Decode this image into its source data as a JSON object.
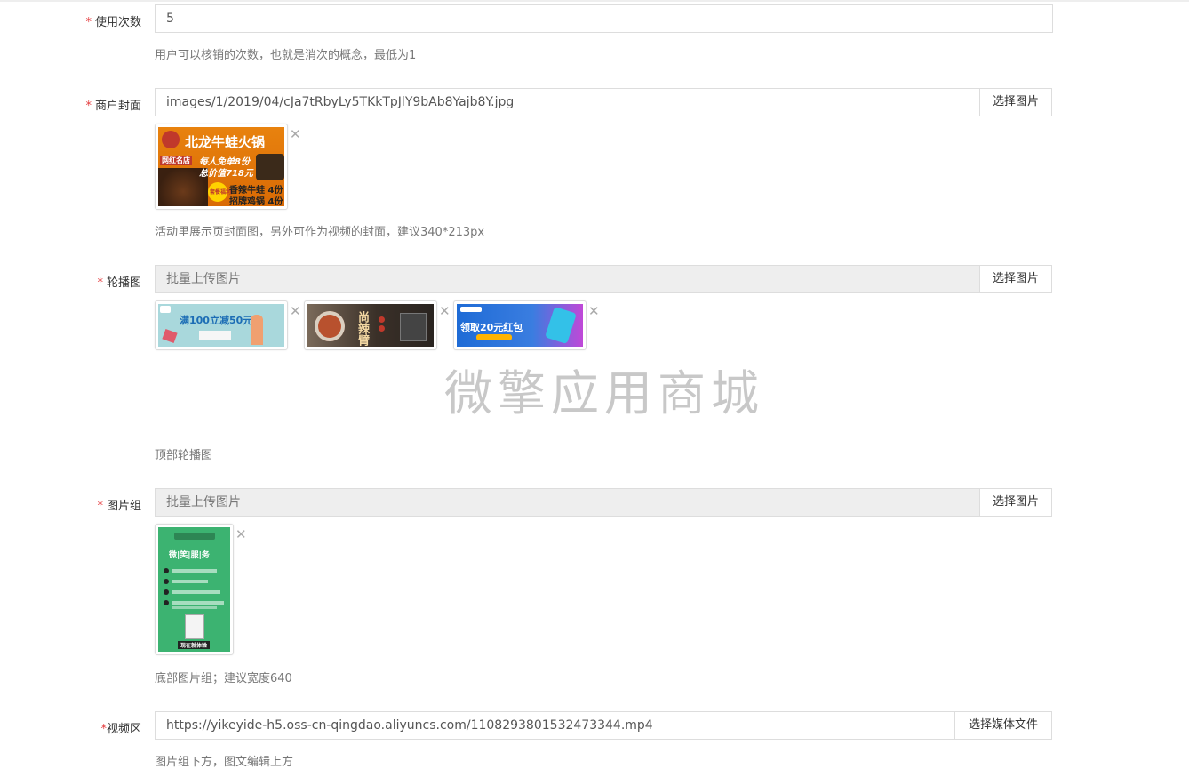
{
  "form": {
    "usage_count": {
      "label": "使用次数",
      "value": "5",
      "help": "用户可以核销的次数，也就是消次的概念，最低为1"
    },
    "merchant_cover": {
      "label": "商户封面",
      "value": "images/1/2019/04/cJa7tRbyLy5TKkTpJlY9bAb8Yajb8Y.jpg",
      "button": "选择图片",
      "help": "活动里展示页封面图，另外可作为视频的封面，建议340*213px",
      "image_text": {
        "headline": "北龙牛蛙火锅",
        "line1": "每人免单8份",
        "line2": "总价值718元",
        "badge": "网红名店",
        "item1": "香辣牛蛙 4份",
        "item2": "招牌鸡锅 4份",
        "seal": "套餐福利"
      }
    },
    "carousel": {
      "label": "轮播图",
      "placeholder": "批量上传图片",
      "button": "选择图片",
      "help": "顶部轮播图",
      "images": [
        {
          "text": "满100立减50元"
        },
        {
          "text": "尚辣臂"
        },
        {
          "text": "领取20元红包"
        }
      ]
    },
    "image_group": {
      "label": "图片组",
      "placeholder": "批量上传图片",
      "button": "选择图片",
      "help": "底部图片组；建议宽度640",
      "image_text": {
        "title": "微|笑|服|务",
        "cta": "现在就体验"
      }
    },
    "video": {
      "label": "视频区",
      "value": "https://yikeyide-h5.oss-cn-qingdao.aliyuncs.com/1108293801532473344.mp4",
      "button": "选择媒体文件",
      "help": "图片组下方，图文编辑上方"
    }
  },
  "watermark": "微擎应用商城",
  "required_mark": "*",
  "close_glyph": "✕",
  "colors": {
    "required": "#e4393c",
    "input_disabled_bg": "#eeeeee",
    "border": "#dddddd"
  }
}
